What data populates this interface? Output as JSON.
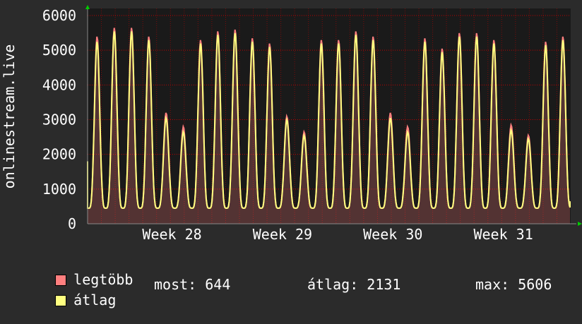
{
  "colors": {
    "background": "#2b2b2b",
    "plot_background": "#1a1a1a",
    "grid": "#cc0000",
    "axis_arrow": "#00cc00",
    "max_series": "#ff7f7f",
    "avg_series": "#ffff80"
  },
  "chart_data": {
    "type": "area",
    "ylabel": "onlinestream.live",
    "ylim": [
      0,
      6000
    ],
    "yticks": [
      0,
      1000,
      2000,
      3000,
      4000,
      5000,
      6000
    ],
    "ytick_labels": [
      "0",
      "1000",
      "2000",
      "3000",
      "4000",
      "5000",
      "6000"
    ],
    "xlim_days": [
      0,
      35
    ],
    "xtick_labels": [
      "Week 28",
      "Week 29",
      "Week 30",
      "Week 31"
    ],
    "xtick_positions_days": [
      5.3,
      13.3,
      21.3,
      29.3
    ],
    "grid": true,
    "legend_position": "bottom",
    "series": [
      {
        "name": "legtöbb",
        "color": "#ff7f7f",
        "daily_peaks": [
          5400,
          5650,
          5650,
          5400,
          3200,
          2800,
          5300,
          5550,
          5600,
          5350,
          5200,
          3100,
          2650,
          5300,
          5300,
          5550,
          5400,
          3200,
          2800,
          5350,
          5050,
          5500,
          5500,
          5300,
          2850,
          2550,
          5250,
          5400
        ]
      },
      {
        "name": "átlag",
        "color": "#ffff80",
        "daily_peaks": [
          5250,
          5550,
          5550,
          5300,
          3050,
          2650,
          5200,
          5450,
          5500,
          5250,
          5100,
          3000,
          2550,
          5200,
          5200,
          5450,
          5300,
          3050,
          2650,
          5250,
          4950,
          5400,
          5400,
          5200,
          2700,
          2450,
          5150,
          5300
        ]
      }
    ],
    "daily_trough": 450,
    "last_value": 644
  },
  "legend": {
    "max_label": "legtöbb",
    "avg_label": "átlag"
  },
  "stats": {
    "current": "most: 644",
    "average": "átlag: 2131",
    "max": "max: 5606"
  }
}
